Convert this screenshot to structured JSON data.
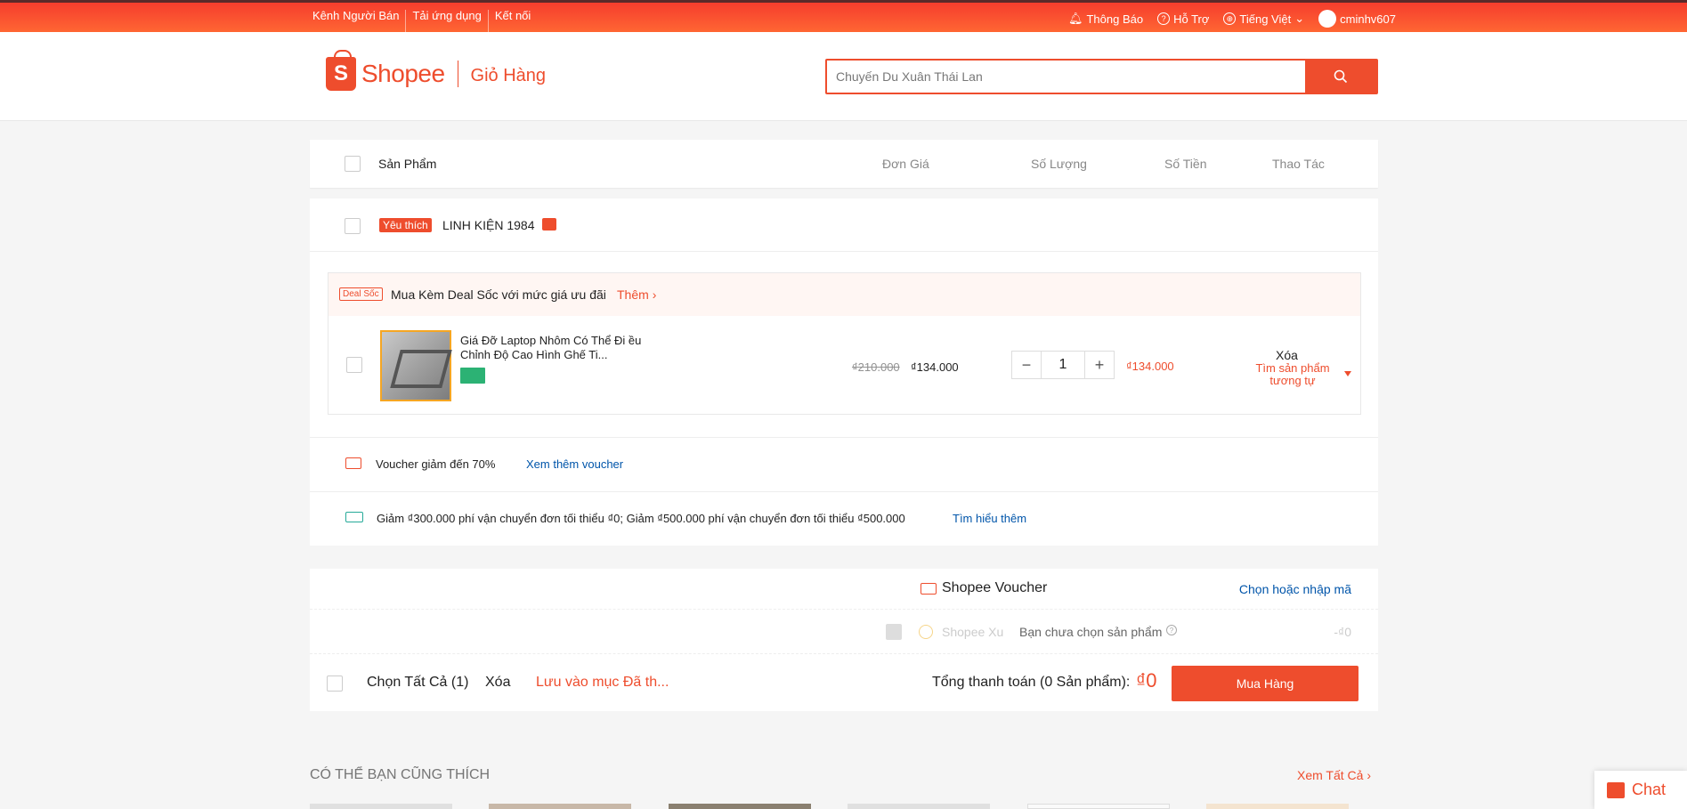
{
  "topbar": {
    "seller_channel": "Kênh Người Bán",
    "download_app": "Tải ứng dụng",
    "connect": "Kết nối",
    "notifications": "Thông Báo",
    "help": "Hỗ Trợ",
    "language": "Tiếng Việt",
    "username": "cminhv607"
  },
  "header": {
    "brand": "Shopee",
    "page_title": "Giỏ Hàng",
    "search_placeholder": "Chuyến Du Xuân Thái Lan"
  },
  "table_head": {
    "product": "Sản Phẩm",
    "unit_price": "Đơn Giá",
    "quantity": "Số Lượng",
    "amount": "Số Tiền",
    "actions": "Thao Tác"
  },
  "shop": {
    "badge": "Yêu thích",
    "name": "LINH KIỆN 1984"
  },
  "deal": {
    "tag": "Deal Sốc",
    "text": "Mua Kèm Deal Sốc với mức giá ưu đãi",
    "more": "Thêm"
  },
  "item": {
    "name": "Giá Đỡ Laptop Nhôm Có Thể Đi ều Chỉnh Độ Cao Hình Ghế Ti...",
    "old_price": "₫210.000",
    "price": "₫134.000",
    "quantity": "1",
    "total": "₫134.000",
    "delete": "Xóa",
    "find_similar": "Tìm sản phẩm tương tự"
  },
  "voucher_row": {
    "text": "Voucher giảm đến 70%",
    "link": "Xem thêm voucher"
  },
  "shipping_row": {
    "text": "Giảm ₫300.000 phí vận chuyển đơn tối thiểu ₫0; Giảm ₫500.000 phí vận chuyển đơn tối thiểu ₫500.000",
    "link": "Tìm hiểu thêm"
  },
  "summary": {
    "shopee_voucher": "Shopee Voucher",
    "choose_code": "Chọn hoặc nhập mã",
    "shopee_coin": "Shopee Xu",
    "no_product": "Bạn chưa chọn sản phẩm",
    "coin_value": "-₫0",
    "select_all": "Chọn Tất Cả (1)",
    "delete": "Xóa",
    "save_later": "Lưu vào mục Đã th...",
    "total_label": "Tổng thanh toán (0 Sản phẩm):",
    "total_value": "₫0",
    "buy": "Mua Hàng"
  },
  "recommend": {
    "title": "CÓ THỂ BẠN CŨNG THÍCH",
    "see_all": "Xem Tất Cả"
  },
  "chat": {
    "label": "Chat"
  },
  "colors": {
    "primary": "#ee4d2d",
    "link": "#05a",
    "teal": "#26aa99"
  }
}
